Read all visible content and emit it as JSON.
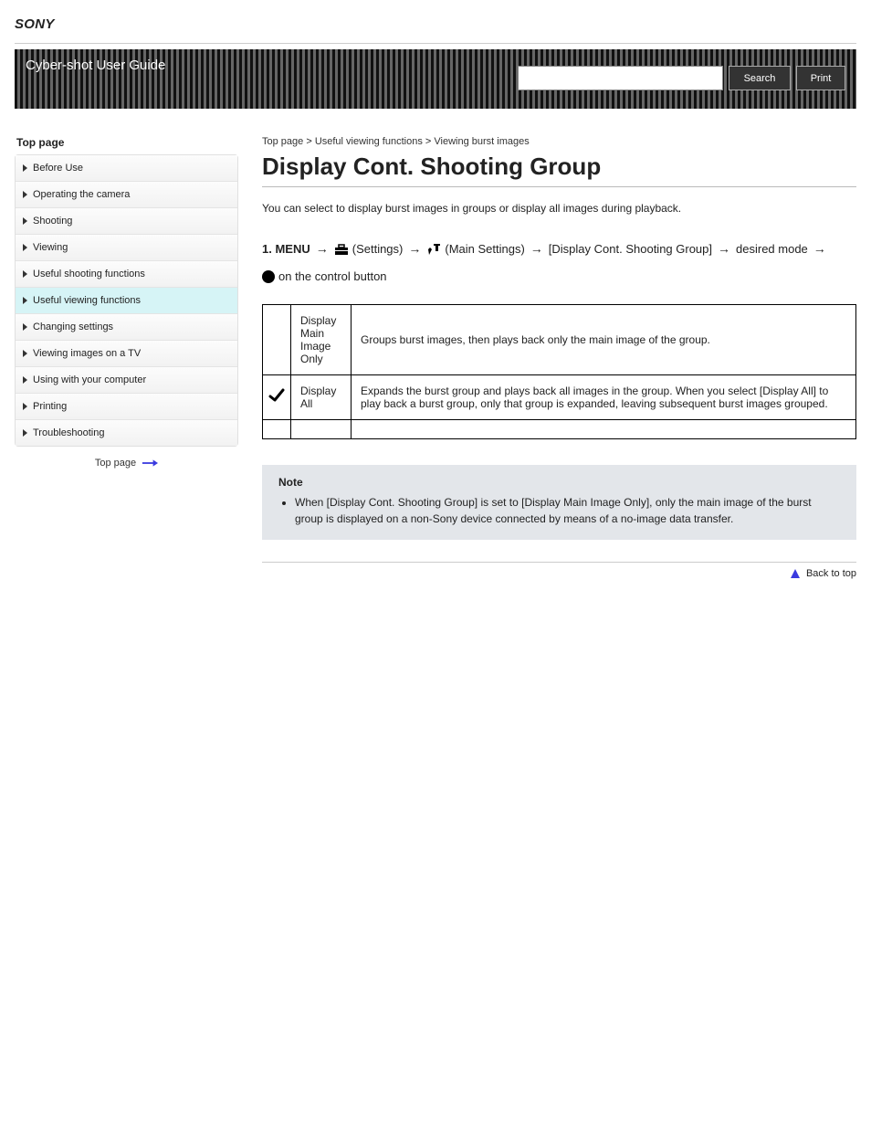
{
  "brand": "SONY",
  "header": {
    "title_l1": "Cyber-shot User Guide",
    "title_l2": ""
  },
  "search": {
    "placeholder": "",
    "search_label": "Search",
    "print_label": "Print"
  },
  "toc_title": "Top page",
  "sidebar": {
    "items": [
      {
        "label": "Before Use"
      },
      {
        "label": "Operating the camera"
      },
      {
        "label": "Shooting"
      },
      {
        "label": "Viewing"
      },
      {
        "label": "Useful shooting functions"
      },
      {
        "label": "Useful viewing functions"
      },
      {
        "label": "Changing settings"
      },
      {
        "label": "Viewing images on a TV"
      },
      {
        "label": "Using with your computer"
      },
      {
        "label": "Printing"
      },
      {
        "label": "Troubleshooting"
      }
    ],
    "active_index": 5
  },
  "top_page_label": "Top page",
  "breadcrumb": [
    "Top page",
    "Useful viewing functions",
    "Viewing burst images"
  ],
  "page_title": "Display Cont. Shooting Group",
  "lead": "You can select to display burst images in groups or display all images during playback.",
  "menu_path": {
    "prefix": "1.  MENU",
    "steps": [
      {
        "icon": "toolbox",
        "label": "(Settings)"
      },
      {
        "icon": "tools",
        "label": "(Main Settings)"
      },
      {
        "label": "[Display Cont. Shooting Group]"
      },
      {
        "label": "desired mode"
      },
      {
        "icon": "bullet",
        "label": "on the control button"
      }
    ]
  },
  "table": {
    "rows": [
      {
        "check": false,
        "label": "Display Main Image Only",
        "desc": "Groups burst images, then plays back only the main image of the group."
      },
      {
        "check": true,
        "label": "Display All",
        "desc": "Expands the burst group and plays back all images in the group. When you select [Display All] to play back a burst group, only that group is expanded, leaving subsequent burst images grouped."
      },
      {
        "check": false,
        "label": "",
        "desc": ""
      }
    ]
  },
  "note": {
    "title": "Note",
    "items": [
      "When [Display Cont. Shooting Group] is set to [Display Main Image Only], only the main image of the burst group is displayed on a non-Sony device connected by means of a no-image data transfer."
    ]
  },
  "back_to_top": "Back to top"
}
